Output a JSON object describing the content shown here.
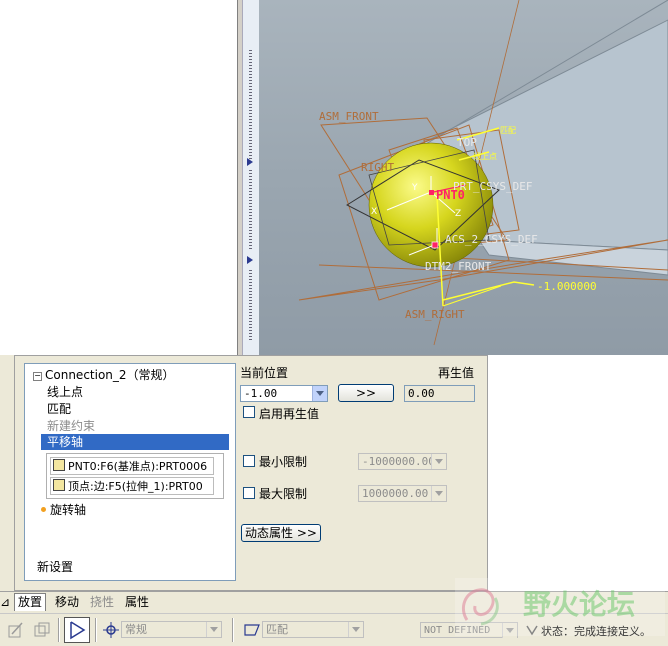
{
  "viewport": {
    "labels": {
      "asm_front": "ASM_FRONT",
      "top": "TOP",
      "right": "RIGHT",
      "prt_csys": "PRT_CSYS_DEF",
      "pnt0": "PNT0",
      "asm_csys": "ACS_2_CSYS_DEF",
      "dtm_front": "DTM2_FRONT",
      "asm_right": "ASM_RIGHT",
      "offset_value": "-1.000000",
      "tag_a": "匹配",
      "tag_b": "线上点",
      "x_axis": "X",
      "y_axis": "Y",
      "z_axis": "Z"
    },
    "colors": {
      "sphere": "#d6d61e",
      "datum": "#b06d3a",
      "highlight": "#ffff33",
      "point": "#ff2266"
    }
  },
  "dashboard": {
    "tree": {
      "root": "Connection_2（常规）",
      "items": [
        "线上点",
        "匹配",
        "新建约束"
      ],
      "selected": "平移轴",
      "references": [
        "PNT0:F6(基准点):PRT0006",
        "顶点:边:F5(拉伸_1):PRT00"
      ],
      "rotate_axis": "旋转轴",
      "new_set": "新设置"
    },
    "current_position_label": "当前位置",
    "regen_value_label": "再生值",
    "current_position_value": "-1.00",
    "apply_button": ">>",
    "regen_value": "0.00",
    "enable_regen": "启用再生值",
    "min_limit_label": "最小限制",
    "min_limit_value": "-1000000.00",
    "max_limit_label": "最大限制",
    "max_limit_value": "1000000.00",
    "dynamic_props_button": "动态属性 >>"
  },
  "tabs": [
    "放置",
    "移动",
    "挠性",
    "属性"
  ],
  "toolbar": {
    "connection_type": "常规",
    "constraint_type": "匹配",
    "definition_status": "NOT DEFINED",
    "status_text": "状态：完成连接定义。"
  },
  "watermark": {
    "text": "野火论坛"
  }
}
